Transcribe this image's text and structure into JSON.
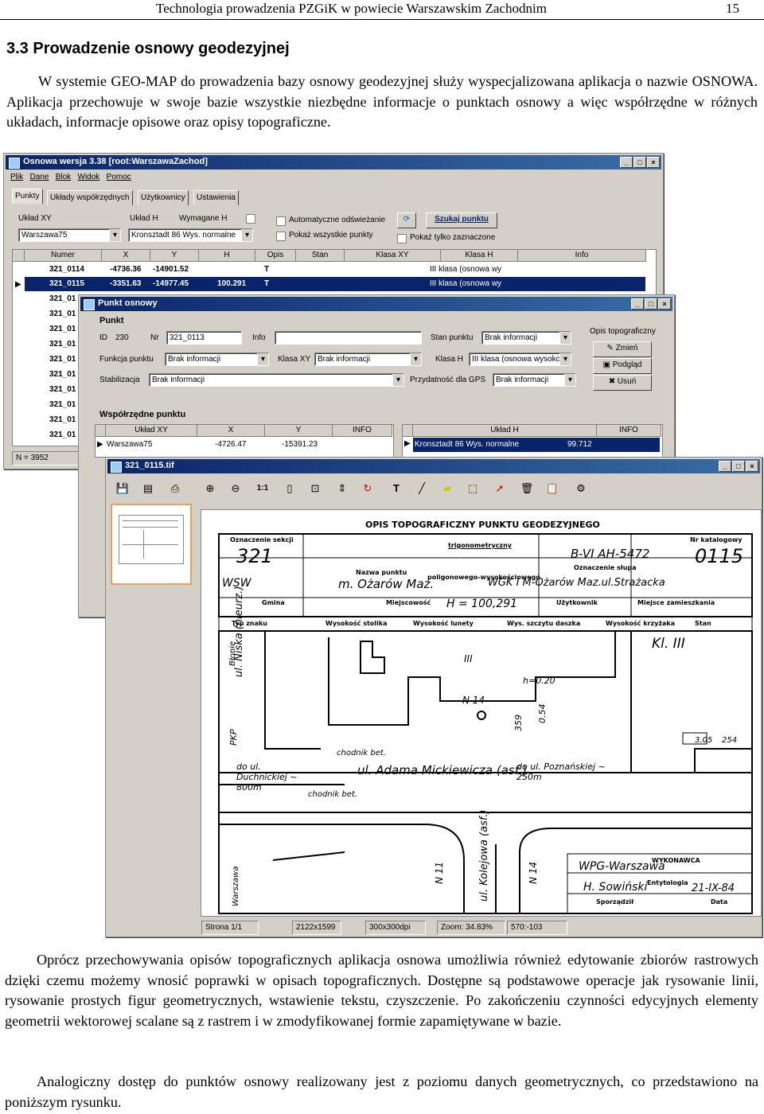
{
  "header": {
    "title": "Technologia prowadzenia PZGiK w powiecie Warszawskim Zachodnim",
    "page": "15"
  },
  "section": {
    "title": "3.3  Prowadzenie osnowy geodezyjnej"
  },
  "intro": "W systemie GEO-MAP do prowadzenia bazy osnowy geodezyjnej służy wyspecjalizowana aplikacja o nazwie OSNOWA. Aplikacja przechowuje w swoje bazie wszystkie niezbędne informacje o punktach osnowy a więc współrzędne w różnych układach, informacje opisowe oraz opisy topograficzne.",
  "main_window": {
    "title": "Osnowa  wersja 3.38  [root:WarszawaZachod]",
    "menu": [
      "Plik",
      "Dane",
      "Blok",
      "Widok",
      "Pomoc"
    ],
    "tabs": [
      "Punkty",
      "Układy współrzędnych",
      "Użytkownicy",
      "Ustawienia"
    ],
    "uklad_xy_label": "Układ XY",
    "uklad_xy_value": "Warszawa75",
    "uklad_h_label": "Układ H",
    "uklad_h_value": "Kronsztadt 86 Wys. normalne",
    "wymagane_h_label": "Wymagane H",
    "auto_refresh": "Automatyczne odświeżanie",
    "show_all": "Pokaż wszystkie punkty",
    "show_selected": "Pokaż tylko zaznaczone",
    "search_button": "Szukaj punktu",
    "columns": [
      "Numer",
      "X",
      "Y",
      "H",
      "Opis",
      "Stan",
      "Klasa XY",
      "Klasa H",
      "Info"
    ],
    "rows": [
      {
        "numer": "321_0114",
        "x": "-4736.36",
        "y": "-14901.52",
        "h": "",
        "opis": "T",
        "klasa_h": "III klasa (osnowa wy"
      },
      {
        "numer": "321_0115",
        "x": "-3351.63",
        "y": "-14977.45",
        "h": "100.291",
        "opis": "T",
        "klasa_h": "III klasa (osnowa wy"
      }
    ],
    "more_rows": [
      "321_01",
      "321_01",
      "321_01",
      "321_01",
      "321_01",
      "321_01",
      "321_01",
      "321_01",
      "321_01",
      "321_01"
    ],
    "count": "N = 3952"
  },
  "point_window": {
    "title": "Punkt osnowy",
    "group_punkt": "Punkt",
    "id_label": "ID",
    "id_value": "230",
    "nr_label": "Nr",
    "nr_value": "321_0113",
    "info_label": "Info",
    "stan_label": "Stan punktu",
    "stan_value": "Brak informacji",
    "funkcja_label": "Funkcja punktu",
    "funkcja_value": "Brak informacji",
    "klasa_xy_label": "Klasa XY",
    "klasa_xy_value": "Brak informacji",
    "klasa_h_label": "Klasa H",
    "klasa_h_value": "III klasa (osnowa wysoko:",
    "stab_label": "Stabilizacja",
    "stab_value": "Brak informacji",
    "gps_label": "Przydatność dla GPS",
    "gps_value": "Brak informacji",
    "opis_group": "Opis topograficzny",
    "btn_zmien": "Zmień",
    "btn_podglad": "Podgląd",
    "btn_usun": "Usuń",
    "coords_group": "Współrzędne punktu",
    "xy_cols": [
      "Układ XY",
      "X",
      "Y",
      "INFO"
    ],
    "xy_row": {
      "uklad": "Warszawa75",
      "x": "-4726.47",
      "y": "-15391.23"
    },
    "h_cols": [
      "Układ H",
      "INFO"
    ],
    "h_row": {
      "uklad": "Kronsztadt 86 Wys. normalne",
      "h": "99.712"
    }
  },
  "raster_window": {
    "title": "321_0115.tif",
    "status": [
      "Strona 1/1",
      "2122x1599",
      "300x300dpi",
      "Zoom: 34.83%",
      "570:-103"
    ],
    "doc": {
      "title": "OPIS TOPOGRAFICZNY PUNKTU GEODEZYJNEGO",
      "sekcja_label": "Oznaczenie sekcji",
      "sekcja_value": "321",
      "katalog_label": "Nr katalogowy",
      "katalog_value": "0115",
      "nazwa_label": "Nazwa punktu",
      "nazwa_value": "m. Ożarów Maz.",
      "rodzaj_label1": "trigonometryczny",
      "rodzaj_label2": "poligonowego-wysokościowego",
      "slup_label": "Oznaczenie słupa",
      "slup_value": "B-VI   AH-5472",
      "wgk_value": "WGK I M-Ożarów Maz.ul.Strażacka",
      "wsw": "WSW",
      "gmina": "Gmina",
      "miejscowosc": "Miejscowość",
      "uzytkownik": "Użytkownik",
      "miejsce": "Miejsce zamieszkania",
      "h_value": "H = 100,291",
      "row2": [
        "Typ znaku",
        "Wysokość stolika",
        "Wysokość lunety",
        "Wys. szczytu daszka",
        "Wysokość krzyżaka",
        "Stan"
      ],
      "klasa": "Kl. III",
      "streets": [
        "ul. Adama Mickiewicza (asf.)",
        "do ul. Duchnickiej ~ 800m",
        "do ul. Poznańskiej ~ 250m",
        "ul. Niska (nieurz.)",
        "ul. Kolejowa (asf.)",
        "chodnik bet.",
        "chodnik bet.",
        "N 14",
        "N 14",
        "N 11",
        "h=0.20",
        "PKP",
        "Błonie",
        "Warszawa",
        "III",
        "359",
        "0.54",
        "3.05",
        "254"
      ],
      "wykonawca_label": "WYKONAWCA",
      "wykonawca_value": "WPG-Warszawa",
      "ent_label": "Entytologia",
      "ent_value": "H. Sowiński",
      "data_label": "Data",
      "data_value": "21-IX-84",
      "sporzadzil": "Sporządził"
    }
  },
  "para2": "Oprócz przechowywania opisów topograficznych aplikacja osnowa umożliwia również edytowanie zbiorów rastrowych dzięki czemu możemy wnosić poprawki w opisach topograficznych. Dostępne są podstawowe operacje jak rysowanie linii, rysowanie prostych figur geometrycznych, wstawienie tekstu, czyszczenie. Po zakończeniu czynności edycyjnych elementy geometrii wektorowej scalane są z rastrem i w zmodyfikowanej formie zapamiętywane w bazie.",
  "para3": "Analogiczny dostęp do punktów osnowy realizowany jest z poziomu danych geometrycznych, co przedstawiono na poniższym rysunku."
}
